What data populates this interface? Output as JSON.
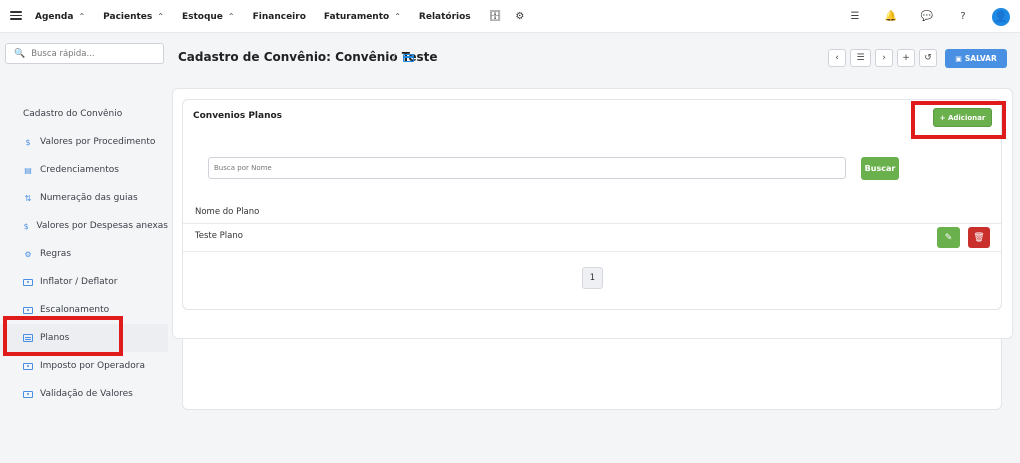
{
  "navbar": {
    "menu": [
      {
        "label": "Agenda",
        "dropdown": true
      },
      {
        "label": "Pacientes",
        "dropdown": true
      },
      {
        "label": "Estoque",
        "dropdown": true
      },
      {
        "label": "Financeiro",
        "dropdown": false
      },
      {
        "label": "Faturamento",
        "dropdown": true
      },
      {
        "label": "Relatórios",
        "dropdown": false
      }
    ],
    "icons": [
      "database-icon",
      "gear-icon"
    ],
    "right_icons": [
      "checklist-icon",
      "bell-icon",
      "chat-icon",
      "help-icon"
    ],
    "avatar_icon": "user-icon"
  },
  "quick_search": {
    "placeholder": "Busca rápida..."
  },
  "header": {
    "title": "Cadastro de Convênio: Convênio Teste",
    "save_label": "SALVAR"
  },
  "sidebar": {
    "items": [
      {
        "label": "Cadastro do Convênio",
        "icon": "card-icon"
      },
      {
        "label": "Valores por Procedimento",
        "icon": "dollar-icon"
      },
      {
        "label": "Credenciamentos",
        "icon": "document-icon"
      },
      {
        "label": "Numeração das guias",
        "icon": "sort-numeric-icon"
      },
      {
        "label": "Valores por Despesas anexas",
        "icon": "dollar-icon"
      },
      {
        "label": "Regras",
        "icon": "cogs-icon"
      },
      {
        "label": "Inflator / Deflator",
        "icon": "money-icon"
      },
      {
        "label": "Escalonamento",
        "icon": "money-icon"
      },
      {
        "label": "Planos",
        "icon": "table-icon"
      },
      {
        "label": "Imposto por Operadora",
        "icon": "money-icon"
      },
      {
        "label": "Validação de Valores",
        "icon": "money-icon"
      }
    ],
    "active_index": 8
  },
  "plans": {
    "title": "Convenios Planos",
    "add_label": "+ Adicionar",
    "search_placeholder": "Busca por Nome",
    "search_label": "Buscar",
    "column_header": "Nome do Plano",
    "rows": [
      {
        "name": "Teste Plano"
      }
    ],
    "page": "1"
  },
  "colors": {
    "primary": "#4a90e2",
    "success": "#6ab04c",
    "danger": "#c9302c",
    "highlight": "#e01b1b"
  }
}
